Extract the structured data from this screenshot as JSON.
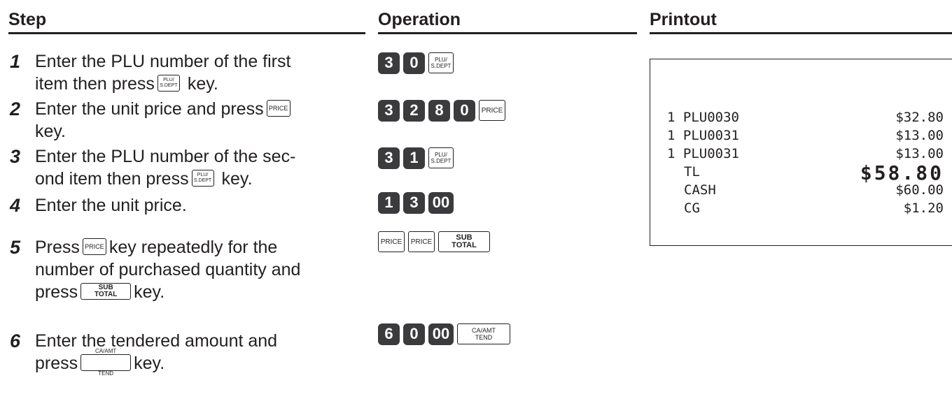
{
  "headers": {
    "step": "Step",
    "operation": "Operation",
    "printout": "Printout"
  },
  "steps": [
    {
      "num": "1",
      "text_a": "Enter the PLU number of the first",
      "text_b1": "item then press",
      "key": "PLU/\nS.DEPT",
      "text_b2": "key."
    },
    {
      "num": "2",
      "text_a1": "Enter the unit price and press",
      "key": "PRICE",
      "text_b": "key."
    },
    {
      "num": "3",
      "text_a": "Enter the PLU number of the sec-",
      "text_b1": "ond item then press",
      "key": "PLU/\nS.DEPT",
      "text_b2": "key."
    },
    {
      "num": "4",
      "text_a": "Enter the unit price."
    },
    {
      "num": "5",
      "text_a1": "Press",
      "key": "PRICE",
      "text_a2": "key repeatedly for the",
      "text_b": "number of purchased quantity and",
      "text_c1": "press",
      "key2": "SUB\nTOTAL",
      "text_c2": "key."
    },
    {
      "num": "6",
      "text_a": "Enter the tendered amount and",
      "text_b1": "press",
      "key": "CA/AMT\nTEND",
      "text_b2": "key."
    }
  ],
  "operations": {
    "op1": [
      "3",
      "0"
    ],
    "op2": [
      "3",
      "2",
      "8",
      "0"
    ],
    "op3": [
      "3",
      "1"
    ],
    "op4": [
      "1",
      "3",
      "00"
    ],
    "op6": [
      "6",
      "0",
      "00"
    ],
    "keys": {
      "plu": "PLU/\nS.DEPT",
      "price": "PRICE",
      "subtotal": "SUB\nTOTAL",
      "ca": "CA/AMT\nTEND"
    }
  },
  "receipt": {
    "items": [
      {
        "qty_name": "1 PLU0030",
        "amount": "$32.80"
      },
      {
        "qty_name": "1 PLU0031",
        "amount": "$13.00"
      },
      {
        "qty_name": "1 PLU0031",
        "amount": "$13.00"
      }
    ],
    "total_label": "TL",
    "total_amount": "$58.80",
    "cash_label": "CASH",
    "cash_amount": "$60.00",
    "change_label": "CG",
    "change_amount": "$1.20"
  }
}
